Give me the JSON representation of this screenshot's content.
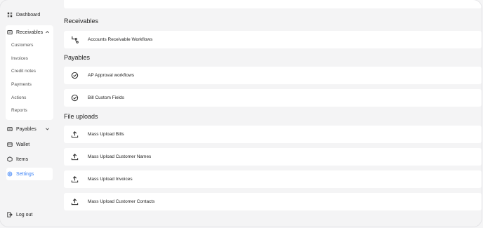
{
  "sidebar": {
    "dashboard": "Dashboard",
    "receivables": "Receivables",
    "sub_items": [
      "Customers",
      "Invoices",
      "Credit notes",
      "Payments",
      "Actions",
      "Reports"
    ],
    "payables": "Payables",
    "wallet": "Wallet",
    "items": "Items",
    "settings": "Settings",
    "logout": "Log out"
  },
  "main": {
    "sections": {
      "receivables_title": "Receivables",
      "payables_title": "Payables",
      "file_uploads_title": "File uploads"
    },
    "rows": {
      "ar_workflows": "Accounts Receivable Workflows",
      "ap_workflows": "AP Approval workflows",
      "bill_fields": "Bill Custom Fields",
      "upload_bills": "Mass Upload Bills",
      "upload_customer_names": "Mass Upload Customer Names",
      "upload_invoices": "Mass Upload Invoices",
      "upload_customer_contacts": "Mass Upload Customer Contacts"
    }
  },
  "colors": {
    "accent": "#3b82f6",
    "background": "#f4f4f5",
    "card": "#ffffff"
  }
}
